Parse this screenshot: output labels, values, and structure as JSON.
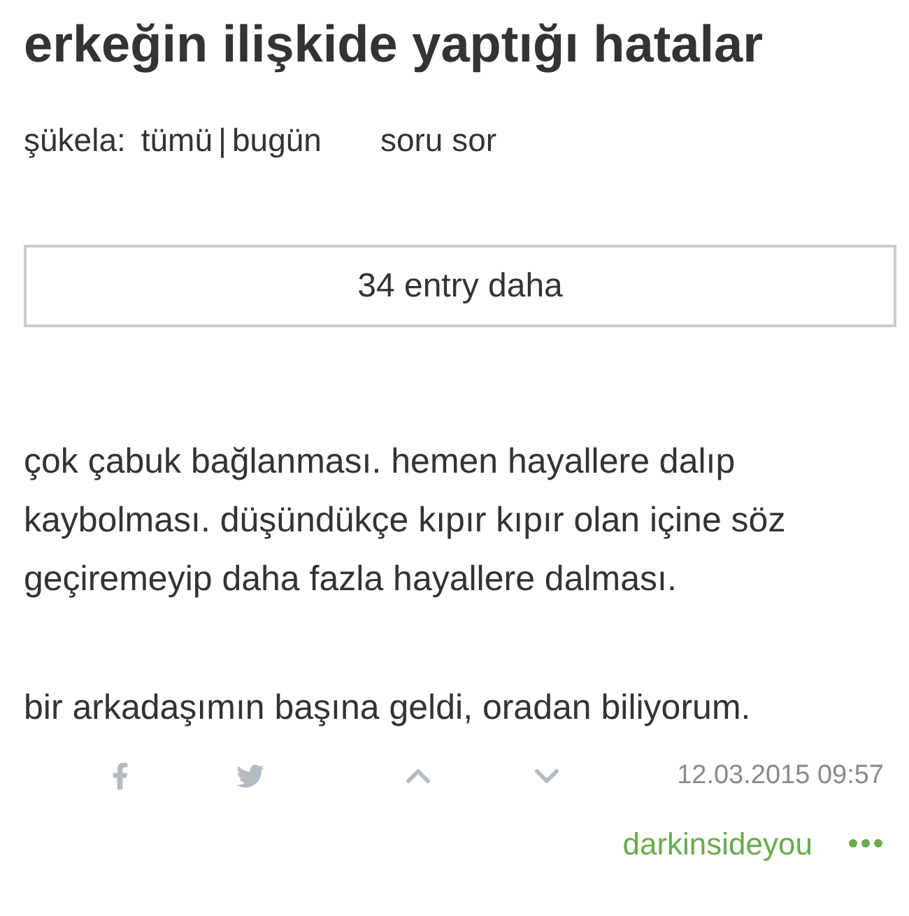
{
  "title": "erkeğin ilişkide yaptığı hatalar",
  "filter_bar": {
    "label": "şükela:",
    "options": [
      {
        "label": "tümü"
      },
      {
        "label": "bugün"
      }
    ],
    "separator": "|",
    "ask_link": "soru sor"
  },
  "more_button": "34 entry daha",
  "entry": {
    "paragraphs": [
      "çok çabuk bağlanması. hemen hayallere dalıp kaybolması. düşündükçe kıpır kıpır olan içine söz geçiremeyip daha fazla hayallere dalması.",
      "bir arkadaşımın başına geldi, oradan biliyorum."
    ],
    "date": "12.03.2015 09:57",
    "author": "darkinsideyou"
  }
}
